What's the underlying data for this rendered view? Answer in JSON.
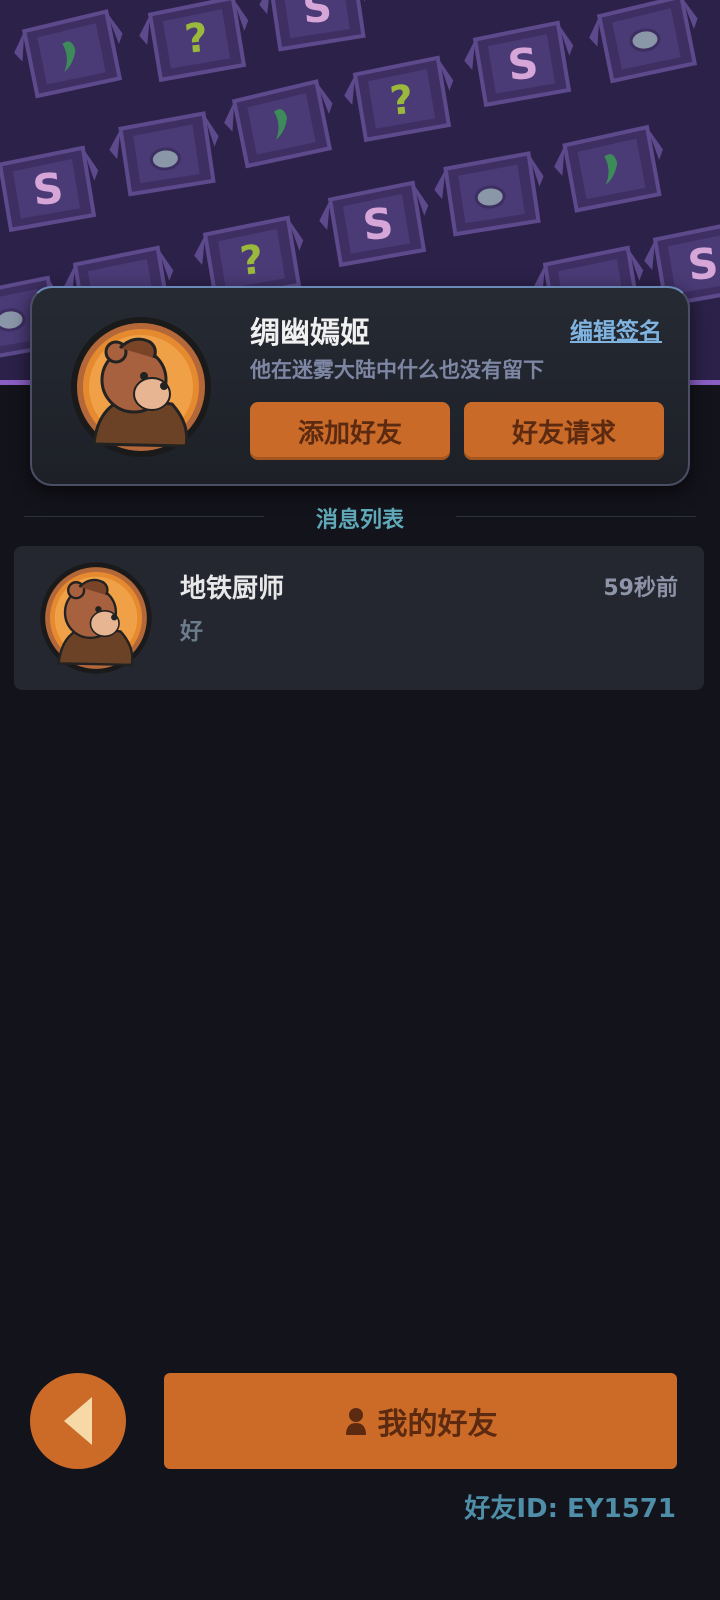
{
  "profile": {
    "name": "绸幽嫣姬",
    "signature": "他在迷雾大陆中什么也没有留下",
    "edit_signature_label": "编辑签名",
    "add_friend_label": "添加好友",
    "friend_request_label": "好友请求"
  },
  "messages": {
    "section_title": "消息列表",
    "items": [
      {
        "name": "地铁厨师",
        "time": "59秒前",
        "text": "好"
      }
    ]
  },
  "bottom": {
    "my_friends_label": "我的好友",
    "friend_id": "好友ID: EY1571"
  },
  "icons": {
    "back": "triangle-left-icon",
    "friends": "person-icon",
    "avatar": "bear-avatar-icon"
  },
  "colors": {
    "accent_orange": "#cc6a28",
    "banner_purple": "#2c2148",
    "background": "#13131b",
    "section_title": "#5fa9b8",
    "link_blue": "#7fb3e0"
  }
}
